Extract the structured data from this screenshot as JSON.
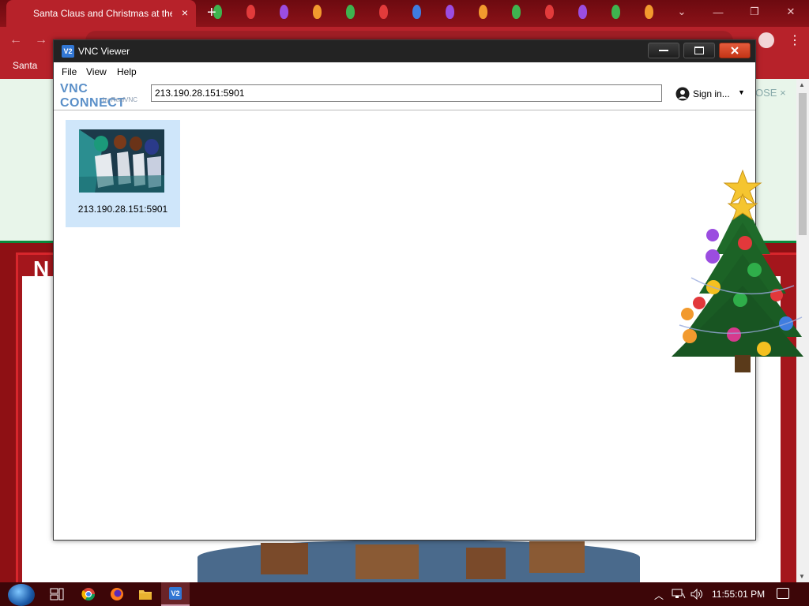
{
  "browser": {
    "tab_title": "Santa Claus and Christmas at the",
    "tab_close": "×",
    "new_tab": "+",
    "bookmark_label": "Santa",
    "close_link": "OSE",
    "close_x": "×",
    "page_letter": "N"
  },
  "vnc": {
    "window_title": "VNC Viewer",
    "app_icon_text": "V2",
    "menu": [
      "File",
      "View",
      "Help"
    ],
    "logo_top": "VNC CONNECT",
    "logo_bottom": "by RealVNC",
    "address_value": "213.190.28.151:5901",
    "signin_label": "Sign in...",
    "connections": [
      {
        "label": "213.190.28.151:5901"
      }
    ]
  },
  "taskbar": {
    "clock": "11:55:01 PM",
    "taskbar_icon_text": "V2"
  },
  "colors": {
    "accent": "#3277d4",
    "tile_selected": "#cfe6fa",
    "browser_red": "#b7222a"
  }
}
